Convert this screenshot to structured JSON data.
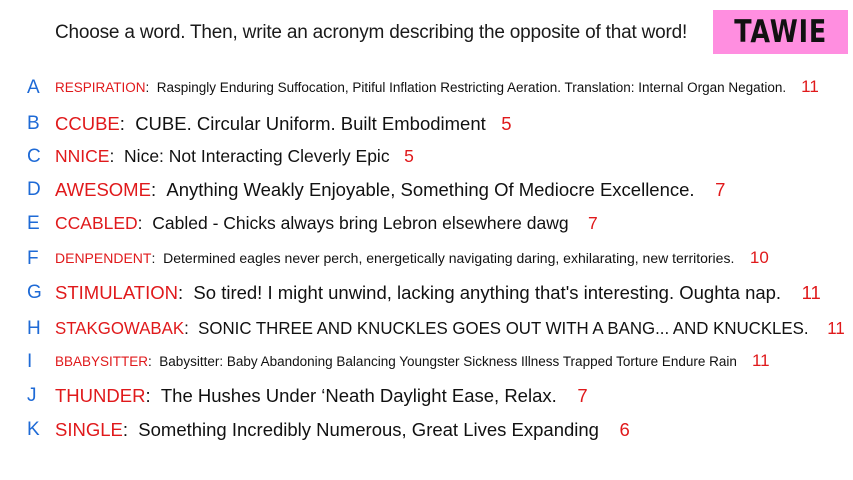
{
  "prompt": "Choose a word. Then, write an acronym describing the opposite of that word!",
  "logo": "TAWIE",
  "colors": {
    "letter": "#1e6ad6",
    "word": "#e0191b",
    "score": "#e0191b",
    "logo_bg": "#ff8ee0"
  },
  "entries": [
    {
      "letter": "A",
      "word": "RESPIRATION",
      "definition": "Raspingly Enduring Suffocation, Pitiful Inflation Restricting Aeration. Translation: Internal Organ Negation.",
      "score": "11"
    },
    {
      "letter": "B",
      "word": "CCUBE",
      "definition": "CUBE. Circular Uniform. Built Embodiment",
      "score": "5"
    },
    {
      "letter": "C",
      "word": "NNICE",
      "definition": "Nice: Not Interacting Cleverly Epic",
      "score": "5"
    },
    {
      "letter": "D",
      "word": "AWESOME",
      "definition": "Anything Weakly Enjoyable, Something Of Mediocre Excellence.",
      "score": "7"
    },
    {
      "letter": "E",
      "word": "CCABLED",
      "definition": "Cabled - Chicks always bring Lebron elsewhere dawg",
      "score": "7"
    },
    {
      "letter": "F",
      "word": "DENPENDENT",
      "definition": "Determined eagles never perch, energetically navigating daring, exhilarating, new territories.",
      "score": "10"
    },
    {
      "letter": "G",
      "word": "STIMULATION",
      "definition": "So tired! I might unwind, lacking anything that's interesting. Oughta nap.",
      "score": "11"
    },
    {
      "letter": "H",
      "word": "STAKGOWABAK",
      "definition": "SONIC THREE AND KNUCKLES GOES OUT WITH A BANG... AND KNUCKLES.",
      "score": "11"
    },
    {
      "letter": "I",
      "word": "BBABYSITTER",
      "definition": "Babysitter: Baby Abandoning Balancing Youngster Sickness Illness Trapped Torture Endure Rain",
      "score": "11"
    },
    {
      "letter": "J",
      "word": "THUNDER",
      "definition": "The Hushes Under ‘Neath Daylight Ease, Relax.",
      "score": "7"
    },
    {
      "letter": "K",
      "word": "SINGLE",
      "definition": "Something Incredibly Numerous, Great Lives Expanding",
      "score": "6"
    }
  ]
}
